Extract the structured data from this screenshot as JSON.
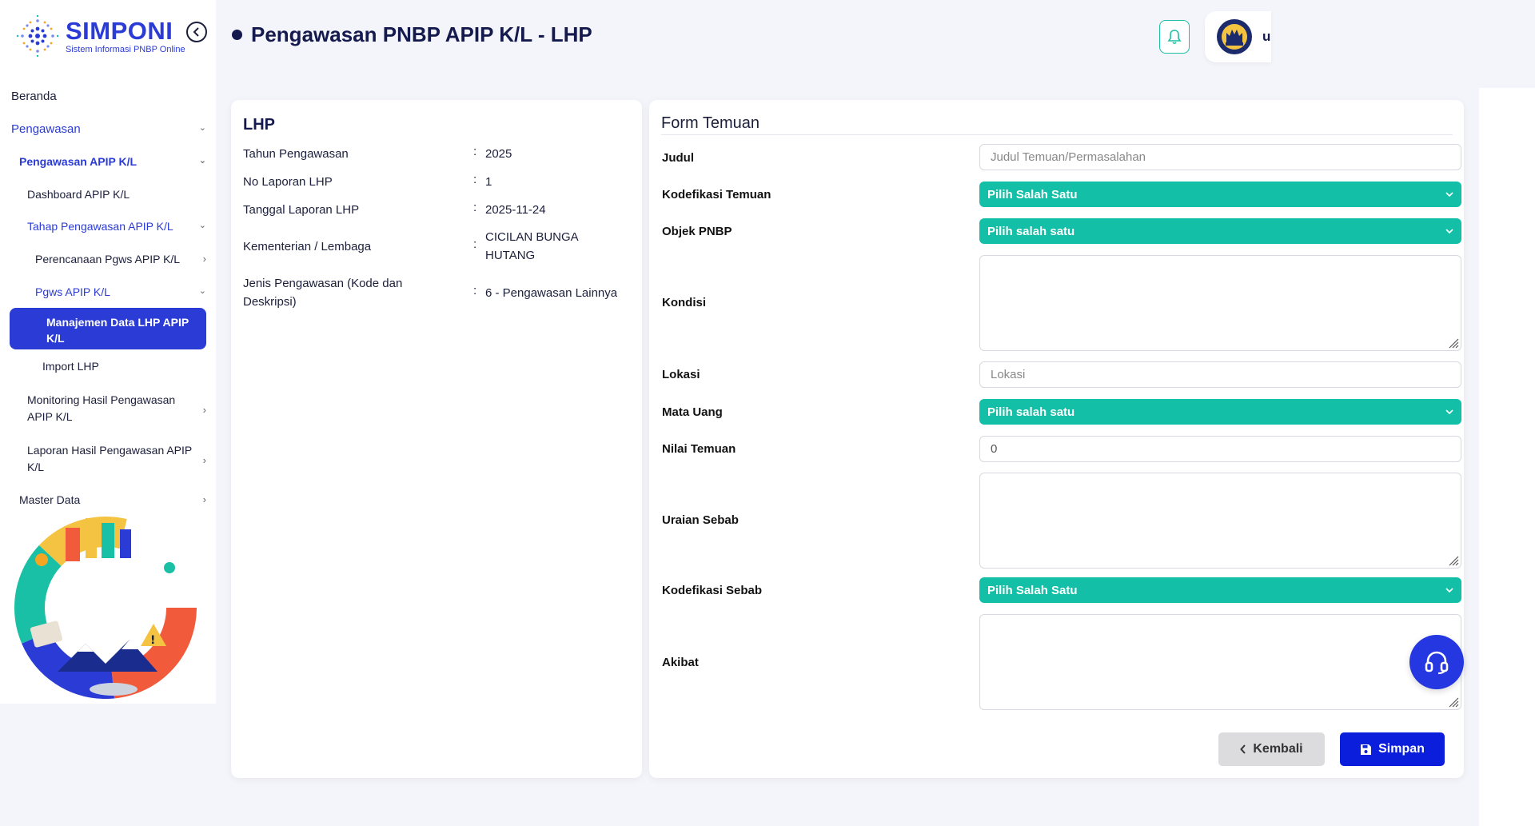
{
  "brand": {
    "name": "SIMPONI",
    "tagline": "Sistem Informasi PNBP Online"
  },
  "header": {
    "title": "Pengawasan PNBP APIP K/L - LHP",
    "user_initial": "u"
  },
  "sidebar": {
    "beranda": "Beranda",
    "pengawasan": "Pengawasan",
    "pengawasan_apip": "Pengawasan APIP K/L",
    "dashboard": "Dashboard APIP K/L",
    "tahap": "Tahap Pengawasan APIP K/L",
    "perencanaan": "Perencanaan Pgws APIP K/L",
    "pgws": "Pgws APIP K/L",
    "manajemen": "Manajemen Data LHP APIP K/L",
    "import": "Import LHP",
    "monitoring": "Monitoring Hasil Pengawasan APIP K/L",
    "laporan": "Laporan Hasil Pengawasan APIP K/L",
    "master": "Master Data"
  },
  "lhp": {
    "title": "LHP",
    "rows": [
      {
        "label": "Tahun Pengawasan",
        "value": "2025"
      },
      {
        "label": "No Laporan LHP",
        "value": "1"
      },
      {
        "label": "Tanggal Laporan LHP",
        "value": "2025-11-24"
      },
      {
        "label": "Kementerian / Lembaga",
        "value": "CICILAN BUNGA HUTANG"
      },
      {
        "label": "Jenis Pengawasan (Kode dan Deskripsi)",
        "value": "6 - Pengawasan Lainnya"
      }
    ]
  },
  "form": {
    "title": "Form Temuan",
    "judul": {
      "label": "Judul",
      "placeholder": "Judul Temuan/Permasalahan"
    },
    "kodefikasi_temuan": {
      "label": "Kodefikasi Temuan",
      "selected": "Pilih Salah Satu"
    },
    "objek_pnbp": {
      "label": "Objek PNBP",
      "selected": "Pilih salah satu"
    },
    "kondisi": {
      "label": "Kondisi"
    },
    "lokasi": {
      "label": "Lokasi",
      "placeholder": "Lokasi"
    },
    "mata_uang": {
      "label": "Mata Uang",
      "selected": "Pilih salah satu"
    },
    "nilai_temuan": {
      "label": "Nilai Temuan",
      "value": "0"
    },
    "uraian_sebab": {
      "label": "Uraian Sebab"
    },
    "kodefikasi_sebab": {
      "label": "Kodefikasi Sebab",
      "selected": "Pilih Salah Satu"
    },
    "akibat": {
      "label": "Akibat"
    },
    "back_label": "Kembali",
    "save_label": "Simpan"
  },
  "colors": {
    "primary": "#2b3bd6",
    "accent": "#13bfa6",
    "save": "#0b1edb"
  }
}
